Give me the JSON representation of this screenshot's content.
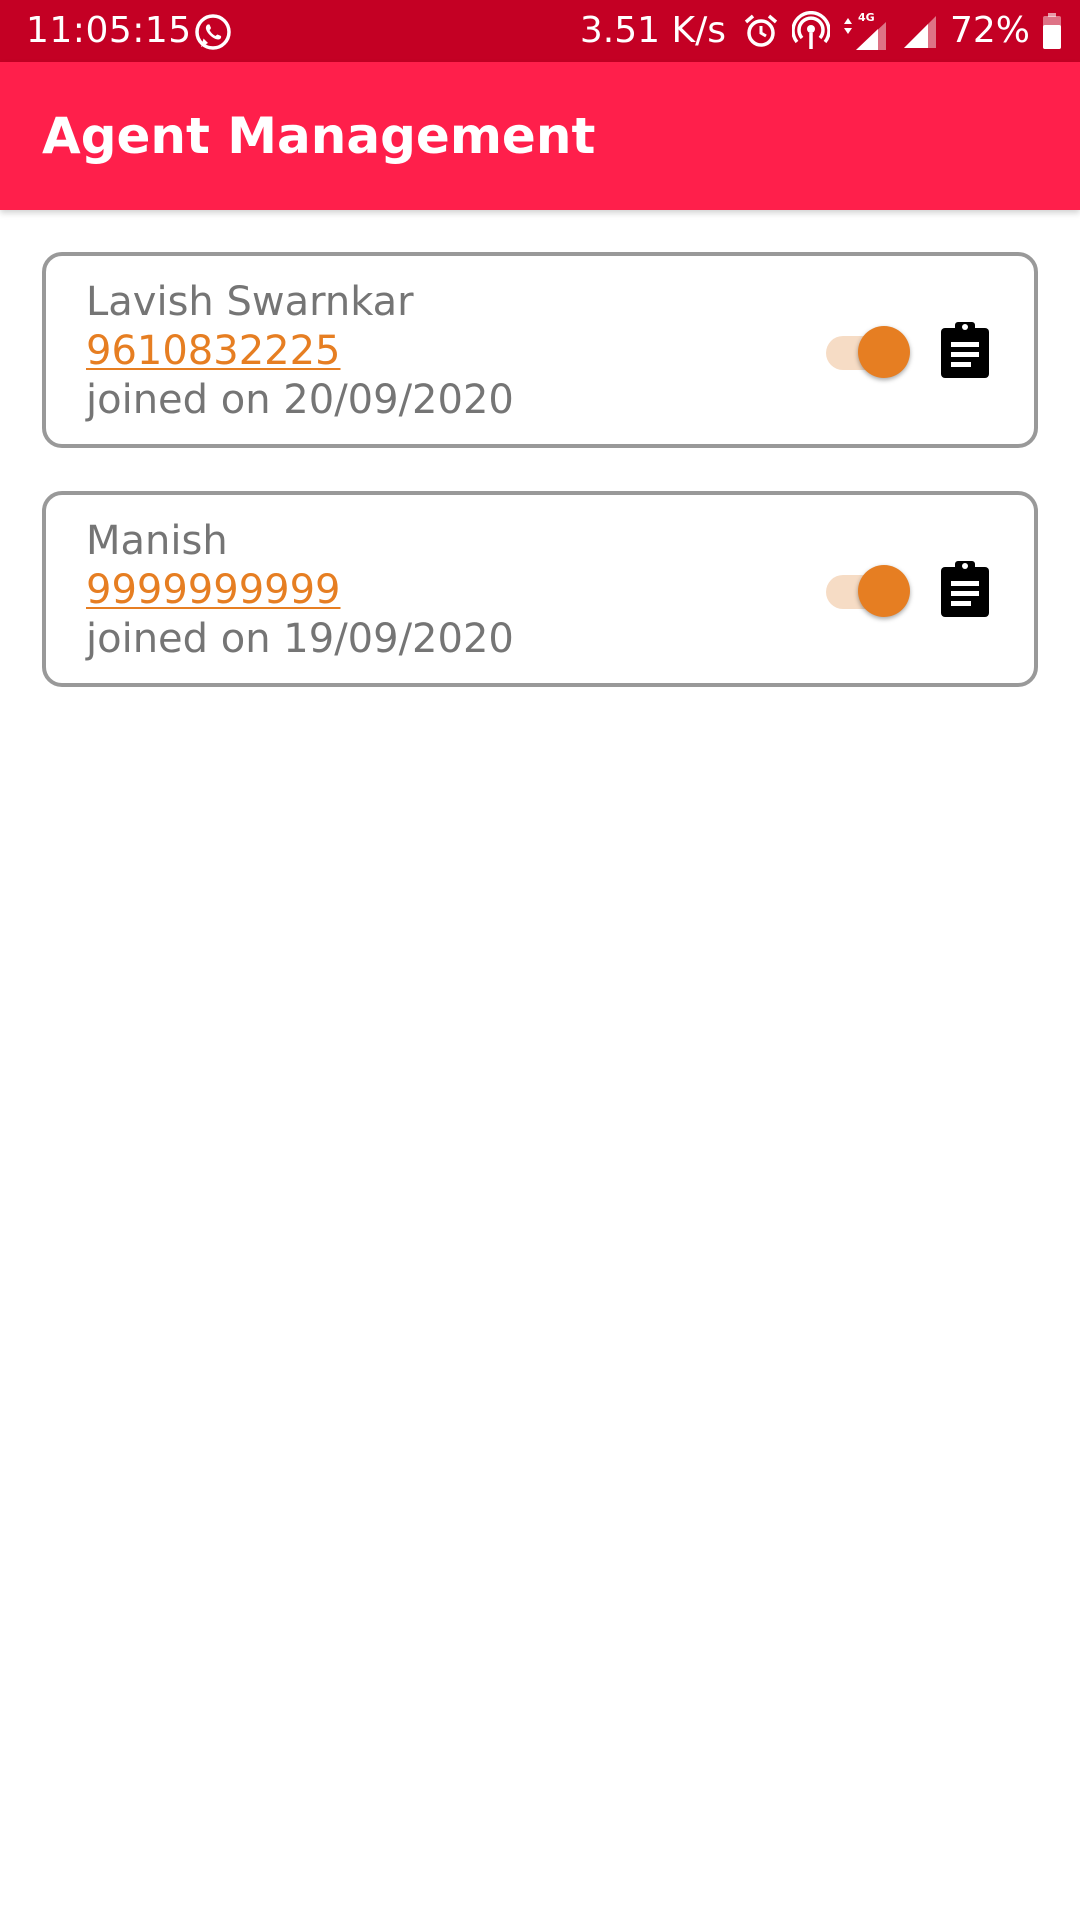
{
  "status_bar": {
    "time": "11:05:15",
    "net_speed": "3.51 K/s",
    "network_type": "4G",
    "battery": "72%",
    "icons": [
      "whatsapp-icon",
      "alarm-icon",
      "hotspot-icon",
      "signal-4g-icon",
      "signal-icon",
      "battery-icon"
    ]
  },
  "app_bar": {
    "title": "Agent Management"
  },
  "agents": [
    {
      "name": "Lavish Swarnkar",
      "phone": "9610832225",
      "joined": "joined on 20/09/2020",
      "active": true
    },
    {
      "name": "Manish",
      "phone": "9999999999",
      "joined": "joined on 19/09/2020",
      "active": true
    }
  ],
  "colors": {
    "status_bar": "#c40024",
    "app_bar": "#ff1f4b",
    "accent": "#e67e22",
    "toggle_track": "#f6dcc5",
    "card_border": "#999999",
    "secondary_text": "#757575"
  }
}
